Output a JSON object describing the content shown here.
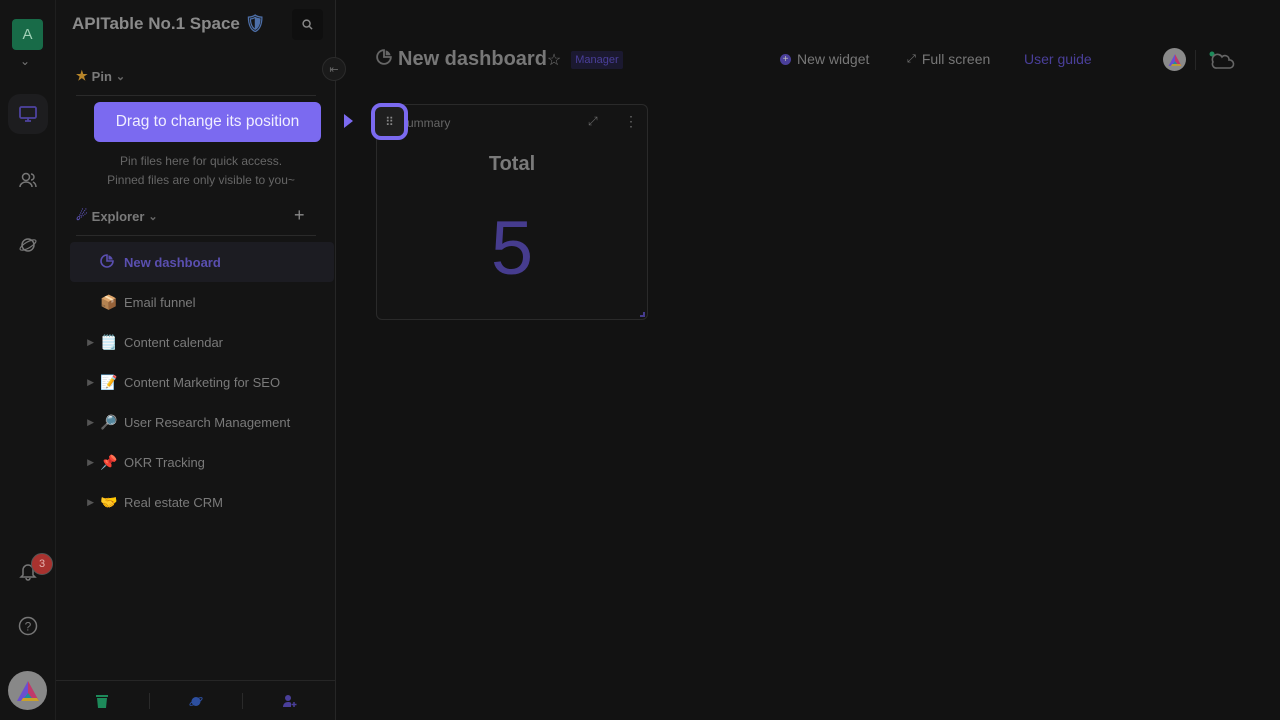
{
  "rail": {
    "space_avatar": "A",
    "notification_count": "3",
    "icons": [
      "workbench-icon",
      "contacts-icon",
      "explore-icon",
      "bell-icon",
      "help-icon"
    ]
  },
  "sidebar": {
    "space_name": "APITable No.1 Space",
    "pin_label": "Pin",
    "pin_hint_line1": "Pin files here for quick access.",
    "pin_hint_line2": "Pinned files are only visible to you~",
    "explorer_label": "Explorer",
    "items": [
      {
        "label": "New dashboard",
        "emoji": "",
        "expandable": false,
        "active": true
      },
      {
        "label": "Email funnel",
        "emoji": "📦",
        "expandable": false,
        "active": false
      },
      {
        "label": "Content calendar",
        "emoji": "🗒️",
        "expandable": true,
        "active": false
      },
      {
        "label": "Content Marketing for SEO",
        "emoji": "📝",
        "expandable": true,
        "active": false
      },
      {
        "label": "User Research Management",
        "emoji": "🔎",
        "expandable": true,
        "active": false
      },
      {
        "label": "OKR Tracking",
        "emoji": "📌",
        "expandable": true,
        "active": false
      },
      {
        "label": "Real estate CRM",
        "emoji": "🤝",
        "expandable": true,
        "active": false
      }
    ]
  },
  "tooltip": {
    "text": "Drag to change its position"
  },
  "header": {
    "title": "New dashboard",
    "role": "Manager",
    "new_widget": "New widget",
    "full_screen": "Full screen",
    "user_guide": "User guide"
  },
  "widget": {
    "name": "Summary",
    "label": "Total",
    "value": "5"
  },
  "colors": {
    "accent": "#7b6af0",
    "space_avatar": "#186b48",
    "badge": "#a8322f"
  }
}
